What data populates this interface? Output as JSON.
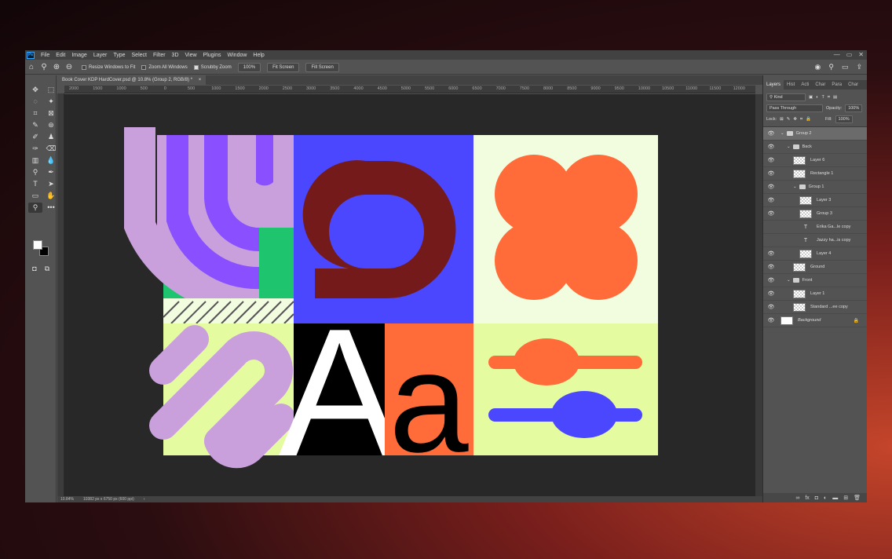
{
  "menu": [
    "File",
    "Edit",
    "Image",
    "Layer",
    "Type",
    "Select",
    "Filter",
    "3D",
    "View",
    "Plugins",
    "Window",
    "Help"
  ],
  "app_logo": "Ps",
  "window_controls": [
    "—",
    "▭",
    "✕"
  ],
  "options": {
    "resize_windows": "Resize Windows to Fit",
    "zoom_all_windows": "Zoom All Windows",
    "scrubby_zoom": "Scrubby Zoom",
    "zoom_100": "100%",
    "fit_screen": "Fit Screen",
    "fill_screen": "Fill Screen"
  },
  "doc_tab": "Book Cover KDP HardCover.psd @ 10.8% (Group 2, RGB/8) *",
  "doc_tab_close": "×",
  "ruler_ticks": [
    "2000",
    "1500",
    "1000",
    "500",
    "0",
    "500",
    "1000",
    "1500",
    "2000",
    "2500",
    "3000",
    "3500",
    "4000",
    "4500",
    "5000",
    "5500",
    "6000",
    "6500",
    "7000",
    "7500",
    "8000",
    "8500",
    "9000",
    "9500",
    "10000",
    "10500",
    "11000",
    "11500",
    "12000"
  ],
  "status": {
    "zoom": "10.84%",
    "doc_size": "10382 px x 6750 px (600 ppi)",
    "arrow": "›"
  },
  "panel": {
    "tabs": [
      "Layers",
      "Hist",
      "Acti",
      "Char",
      "Para",
      "Char"
    ],
    "kind_label": "Kind",
    "blend_mode": "Pass Through",
    "opacity_label": "Opacity:",
    "opacity_value": "100%",
    "lock_label": "Lock:",
    "fill_label": "Fill:",
    "fill_value": "100%"
  },
  "layers": [
    {
      "name": "Group 2",
      "type": "folder",
      "depth": 0,
      "visible": true,
      "selected": true
    },
    {
      "name": "Back",
      "type": "folder",
      "depth": 1,
      "visible": true
    },
    {
      "name": "Layer 6",
      "type": "pixel",
      "depth": 2,
      "visible": true
    },
    {
      "name": "Rectangle 1",
      "type": "pixel",
      "depth": 2,
      "visible": true
    },
    {
      "name": "Group 1",
      "type": "folder",
      "depth": 2,
      "visible": true
    },
    {
      "name": "Layer 3",
      "type": "pixel",
      "depth": 3,
      "visible": true
    },
    {
      "name": "Group 3",
      "type": "pixel",
      "depth": 3,
      "visible": true
    },
    {
      "name": "Erika Ga...le copy",
      "type": "text",
      "depth": 3,
      "visible": false
    },
    {
      "name": "Jazzy ha...is copy",
      "type": "text",
      "depth": 3,
      "visible": false
    },
    {
      "name": "Layer 4",
      "type": "pixel",
      "depth": 3,
      "visible": true
    },
    {
      "name": "Ground",
      "type": "pixel",
      "depth": 2,
      "visible": true
    },
    {
      "name": "Front",
      "type": "folder",
      "depth": 1,
      "visible": true
    },
    {
      "name": "Layer 1",
      "type": "pixel",
      "depth": 2,
      "visible": true
    },
    {
      "name": "Standard ...ee copy",
      "type": "pixel",
      "depth": 2,
      "visible": true
    },
    {
      "name": "Background",
      "type": "background",
      "depth": 0,
      "visible": true,
      "locked": true
    }
  ],
  "art": {
    "letter_big": "A",
    "letter_small": "a"
  },
  "colors": {
    "purple": "#8a4fff",
    "lilac": "#c9a0dc",
    "green": "#1fc46e",
    "blue": "#4b47ff",
    "maroon": "#741a1a",
    "orange": "#ff6c3a",
    "mint": "#f2fde0",
    "lime": "#e5fb9f"
  }
}
